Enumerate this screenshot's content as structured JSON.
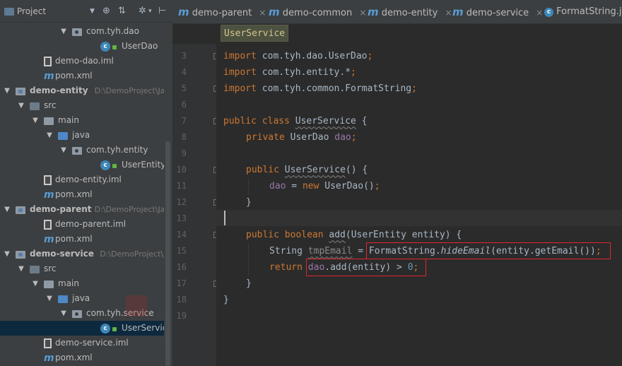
{
  "project_panel": {
    "title": "Project",
    "toolbar_icons": [
      "dropdown-caret-icon",
      "target-icon",
      "collapse-icon",
      "gear-icon",
      "pin-icon"
    ],
    "tree": [
      {
        "label": "com.tyh.dao",
        "type": "package",
        "indent": 4,
        "expanded": true
      },
      {
        "label": "UserDao",
        "type": "class",
        "indent": 6
      },
      {
        "label": "demo-dao.iml",
        "type": "iml",
        "indent": 2
      },
      {
        "label": "pom.xml",
        "type": "pom",
        "indent": 2
      },
      {
        "label": "demo-entity",
        "type": "module",
        "indent": 0,
        "expanded": true,
        "path": "D:\\DemoProject\\Java"
      },
      {
        "label": "src",
        "type": "folder-src",
        "indent": 1,
        "expanded": true
      },
      {
        "label": "main",
        "type": "folder",
        "indent": 2,
        "expanded": true
      },
      {
        "label": "java",
        "type": "folder-blue",
        "indent": 3,
        "expanded": true
      },
      {
        "label": "com.tyh.entity",
        "type": "package",
        "indent": 4,
        "expanded": true
      },
      {
        "label": "UserEntity",
        "type": "class",
        "indent": 6
      },
      {
        "label": "demo-entity.iml",
        "type": "iml",
        "indent": 2
      },
      {
        "label": "pom.xml",
        "type": "pom",
        "indent": 2
      },
      {
        "label": "demo-parent",
        "type": "module",
        "indent": 0,
        "expanded": true,
        "path": "D:\\DemoProject\\Java"
      },
      {
        "label": "demo-parent.iml",
        "type": "iml",
        "indent": 2
      },
      {
        "label": "pom.xml",
        "type": "pom",
        "indent": 2
      },
      {
        "label": "demo-service",
        "type": "module",
        "indent": 0,
        "expanded": true,
        "path": "D:\\DemoProject\\Java"
      },
      {
        "label": "src",
        "type": "folder-src",
        "indent": 1,
        "expanded": true
      },
      {
        "label": "main",
        "type": "folder",
        "indent": 2,
        "expanded": true
      },
      {
        "label": "java",
        "type": "folder-blue",
        "indent": 3,
        "expanded": true
      },
      {
        "label": "com.tyh.service",
        "type": "package",
        "indent": 4,
        "expanded": true
      },
      {
        "label": "UserService",
        "type": "class",
        "indent": 6,
        "selected": true
      },
      {
        "label": "demo-service.iml",
        "type": "iml",
        "indent": 2
      },
      {
        "label": "pom.xml",
        "type": "pom",
        "indent": 2
      }
    ]
  },
  "editor": {
    "tabs": [
      {
        "label": "demo-parent",
        "icon": "m",
        "close": "×"
      },
      {
        "label": "demo-common",
        "icon": "m",
        "close": "×"
      },
      {
        "label": "demo-entity",
        "icon": "m",
        "close": "×"
      },
      {
        "label": "demo-service",
        "icon": "m",
        "close": "×"
      },
      {
        "label": "FormatString.java",
        "icon": "c",
        "close": ""
      }
    ],
    "breadcrumb": "UserService",
    "line_numbers": [
      "3",
      "4",
      "5",
      "6",
      "7",
      "8",
      "9",
      "10",
      "11",
      "12",
      "13",
      "14",
      "15",
      "16",
      "17",
      "18",
      "19"
    ],
    "code": {
      "l3_kw": "import",
      "l3_rest": " com.tyh.dao.UserDao",
      "l3_semi": ";",
      "l4_kw": "import",
      "l4_rest": " com.tyh.entity.*",
      "l4_semi": ";",
      "l5_kw": "import",
      "l5_rest": " com.tyh.common.FormatString",
      "l5_semi": ";",
      "l7_kw": "public class ",
      "l7_name": "UserService",
      "l7_rest": " {",
      "l8_kw": "private ",
      "l8_type": "UserDao ",
      "l8_field": "dao",
      "l8_semi": ";",
      "l10_kw": "public ",
      "l10_name": "UserService",
      "l10_rest": "() {",
      "l11_field": "dao",
      "l11_eq": " = ",
      "l11_kw": "new ",
      "l11_rest": "UserDao()",
      "l11_semi": ";",
      "l12": "}",
      "l14_kw": "public boolean ",
      "l14_name": "add",
      "l14_rest": "(UserEntity entity) {",
      "l15_type": "String ",
      "l15_var": "tmpEmail",
      "l15_eq": " = ",
      "l15_cls": "FormatString.",
      "l15_method": "hideEmail",
      "l15_rest": "(entity.getEmail())",
      "l15_semi": ";",
      "l16_kw": "return ",
      "l16_field": "dao",
      "l16_rest": ".add(entity) > ",
      "l16_num": "0",
      "l16_semi": ";",
      "l17": "}",
      "l18": "}"
    }
  }
}
